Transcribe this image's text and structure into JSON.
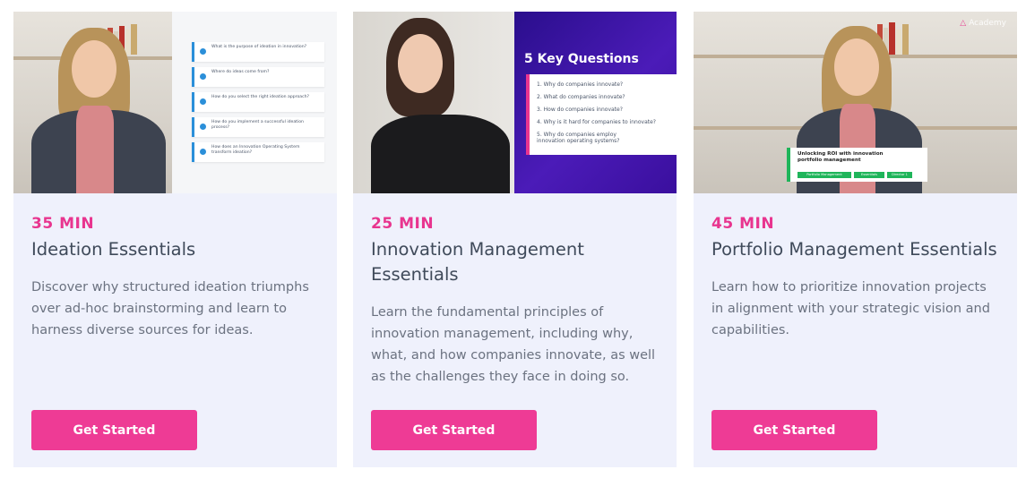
{
  "cards": [
    {
      "duration": "35 MIN",
      "title": "Ideation Essentials",
      "description": "Discover why structured ideation triumphs over ad-hoc brainstorming and learn to harness diverse sources for ideas.",
      "button_label": "Get Started",
      "thumbnail": {
        "questions": [
          "What is the purpose of ideation in innovation?",
          "Where do ideas come from?",
          "How do you select the right ideation approach?",
          "How do you implement a successful ideation process?",
          "How does an Innovation Operating System transform ideation?"
        ]
      }
    },
    {
      "duration": "25 MIN",
      "title": "Innovation Management Essentials",
      "description": "Learn the fundamental principles of innovation management, including why, what, and how companies innovate, as well as the challenges they face in doing so.",
      "button_label": "Get Started",
      "thumbnail": {
        "heading": "5 Key Questions",
        "questions": [
          "1. Why do companies innovate?",
          "2. What do companies innovate?",
          "3. How do companies innovate?",
          "4. Why is it hard for companies to innovate?",
          "5. Why do companies employ innovation operating systems?"
        ]
      }
    },
    {
      "duration": "45 MIN",
      "title": "Portfolio Management Essentials",
      "description": "Learn how to prioritize innovation projects in alignment with your strategic vision and capabilities.",
      "button_label": "Get Started",
      "thumbnail": {
        "logo_text": "Academy",
        "banner_title": "Unlocking ROI with innovation portfolio management",
        "tags": [
          "Portfolio Management",
          "Essentials",
          "Director 1"
        ]
      }
    }
  ],
  "colors": {
    "accent": "#e8358f",
    "button": "#ee3b95",
    "card_bg": "#eff1fc",
    "title_text": "#3f4a5a",
    "body_text": "#6b7280"
  }
}
